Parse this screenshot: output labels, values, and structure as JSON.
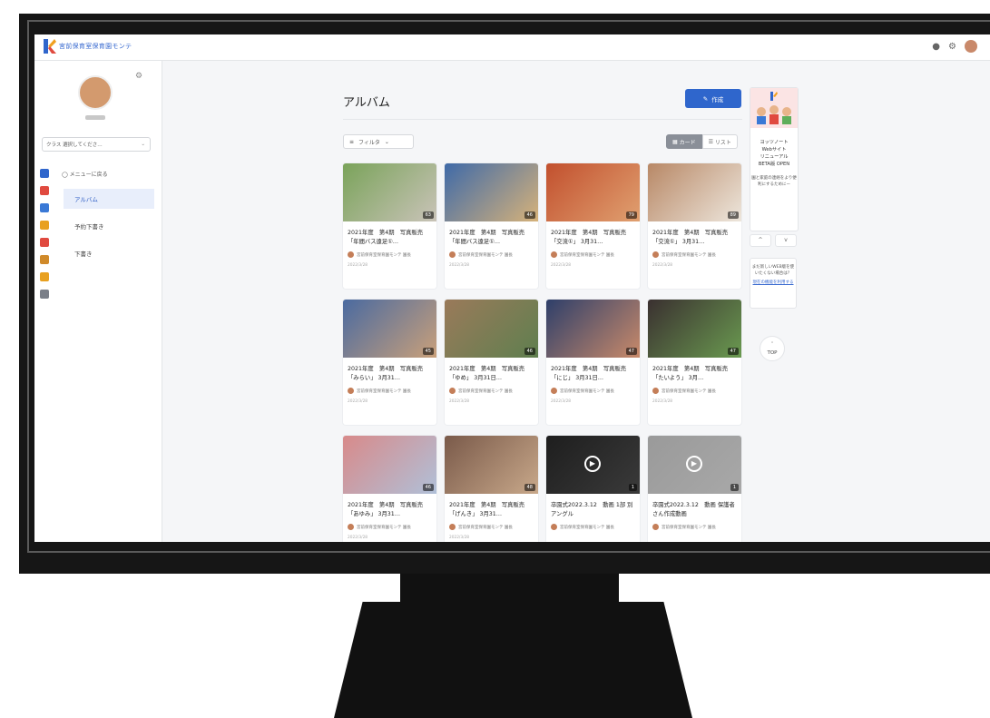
{
  "app": {
    "brand": "宮前保育室保育園モンテ"
  },
  "header": {
    "icons": [
      "bell-icon",
      "gear-icon",
      "user-avatar"
    ]
  },
  "sidebar": {
    "class_select_label": "クラス",
    "class_select_value": "選択してくださ…",
    "back_label": "メニューに戻る",
    "items": [
      {
        "label": "アルバム",
        "active": true
      },
      {
        "label": "予約下書き",
        "active": false
      },
      {
        "label": "下書き",
        "active": false
      }
    ],
    "rail_icons": [
      {
        "name": "k-logo-icon",
        "color": "#2f66cc"
      },
      {
        "name": "calendar-icon",
        "color": "#e04a3f"
      },
      {
        "name": "checklist-icon",
        "color": "#3a79d6"
      },
      {
        "name": "star-icon",
        "color": "#e8a020"
      },
      {
        "name": "date-icon",
        "color": "#e04a3f"
      },
      {
        "name": "yen-icon",
        "color": "#d08a2a"
      },
      {
        "name": "home-icon",
        "color": "#e8a020"
      },
      {
        "name": "settings-icon",
        "color": "#7a7f88"
      }
    ]
  },
  "main": {
    "title": "アルバム",
    "create_label": "作成",
    "filter_label": "フィルタ",
    "view_card_label": "カード",
    "view_list_label": "リスト"
  },
  "cards": [
    {
      "title": "2021年度　第4期　写真販売「年間バス遠足①…",
      "author": "宮前保育室保育園モンテ 園長",
      "date": "2022/3/28",
      "count": "63",
      "video": false,
      "thumb": [
        "#7aa35a",
        "#c9c3b8"
      ]
    },
    {
      "title": "2021年度　第4期　写真販売「年間バス遠足①…",
      "author": "宮前保育室保育園モンテ 園長",
      "date": "2022/3/28",
      "count": "46",
      "video": false,
      "thumb": [
        "#3f6aa8",
        "#d6b27a"
      ]
    },
    {
      "title": "2021年度　第4期　写真販売「交流①」 3月31…",
      "author": "宮前保育室保育園モンテ 園長",
      "date": "2022/3/28",
      "count": "79",
      "video": false,
      "thumb": [
        "#c2502e",
        "#e0a070"
      ]
    },
    {
      "title": "2021年度　第4期　写真販売「交流①」 3月31…",
      "author": "宮前保育室保育園モンテ 園長",
      "date": "2022/3/28",
      "count": "89",
      "video": false,
      "thumb": [
        "#b88866",
        "#ede6dc"
      ]
    },
    {
      "title": "2021年度　第4期　写真販売「みらい」 3月31…",
      "author": "宮前保育室保育園モンテ 園長",
      "date": "2022/3/28",
      "count": "45",
      "video": false,
      "thumb": [
        "#4a6aa0",
        "#c9a07a"
      ]
    },
    {
      "title": "2021年度　第4期　写真販売「ゆめ」 3月31日…",
      "author": "宮前保育室保育園モンテ 園長",
      "date": "2022/3/28",
      "count": "46",
      "video": false,
      "thumb": [
        "#9a7a5a",
        "#5f7f4f"
      ]
    },
    {
      "title": "2021年度　第4期　写真販売「にじ」 3月31日…",
      "author": "宮前保育室保育園モンテ 園長",
      "date": "2022/3/28",
      "count": "47",
      "video": false,
      "thumb": [
        "#2e3f6a",
        "#c98a6a"
      ]
    },
    {
      "title": "2021年度　第4期　写真販売「たいよう」 3月…",
      "author": "宮前保育室保育園モンテ 園長",
      "date": "2022/3/28",
      "count": "47",
      "video": false,
      "thumb": [
        "#3a3030",
        "#6a9a50"
      ]
    },
    {
      "title": "2021年度　第4期　写真販売「あゆみ」 3月31…",
      "author": "宮前保育室保育園モンテ 園長",
      "date": "2022/3/28",
      "count": "46",
      "video": false,
      "thumb": [
        "#d88a8a",
        "#b0c0d8"
      ]
    },
    {
      "title": "2021年度　第4期　写真販売「げんき」 3月31…",
      "author": "宮前保育室保育園モンテ 園長",
      "date": "2022/3/28",
      "count": "48",
      "video": false,
      "thumb": [
        "#7a5a4a",
        "#c8a88a"
      ]
    },
    {
      "title": "卒園式2022.3.12　動画 1部 別アングル",
      "author": "宮前保育室保育園モンテ 園長",
      "date": "",
      "count": "1",
      "video": true,
      "thumb": [
        "#1e1e1e",
        "#3a3a3a"
      ]
    },
    {
      "title": "卒園式2022.3.12　動画 保護者さん作成動画",
      "author": "宮前保育室保育園モンテ 園長",
      "date": "",
      "count": "1",
      "video": true,
      "thumb": [
        "#9a9a9a",
        "#a8a8a8"
      ]
    }
  ],
  "right_rail": {
    "banner_line1": "ヨッツノート",
    "banner_line2": "Webサイト",
    "banner_line3": "リニューアル",
    "banner_line4": "BETA版 OPEN",
    "banner_sub": "園と家庭の連絡をより便利にするためにー",
    "arrow_up": "^",
    "arrow_down": "v",
    "help_text": "まだ新しいWEB版を使いたくない場合は？",
    "help_link": "現在の機能を利用する",
    "top_label": "TOP"
  }
}
